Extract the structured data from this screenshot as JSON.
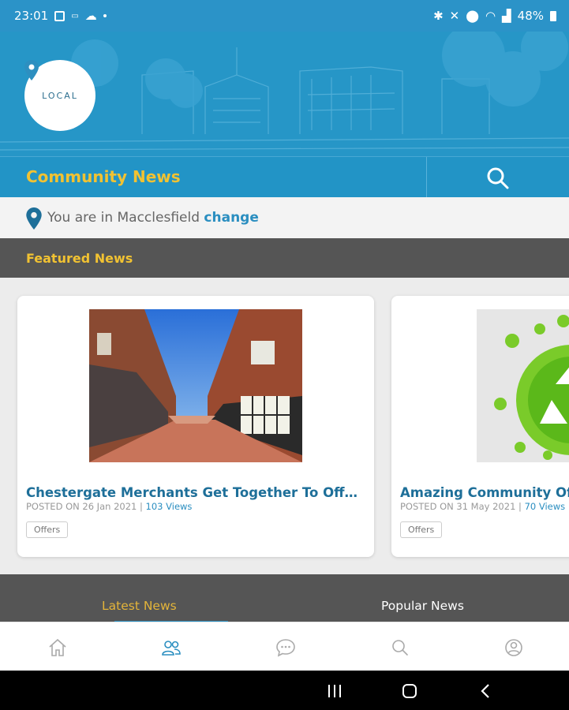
{
  "status_bar": {
    "time": "23:01",
    "battery": "48%"
  },
  "header": {
    "logo_text": "LOCAL",
    "title": "Community News"
  },
  "location": {
    "prefix": "You are in Macclesfield",
    "change_label": "change"
  },
  "featured": {
    "heading": "Featured News"
  },
  "cards": [
    {
      "title": "Chestergate Merchants Get Together To Offer ...",
      "posted": "POSTED ON 26 Jan 2021 |",
      "views": "103 Views",
      "tag": "Offers"
    },
    {
      "title": "Amazing Community Offers",
      "posted": "POSTED ON 31 May 2021 |",
      "views": "70 Views",
      "tag": "Offers"
    }
  ],
  "tabs": {
    "latest": "Latest News",
    "popular": "Popular News"
  },
  "bottom_nav": [
    "home-icon",
    "community-icon",
    "chat-icon",
    "search-icon",
    "profile-icon"
  ],
  "colors": {
    "brand_blue": "#2294c6",
    "accent_yellow": "#f1c232",
    "dark_bar": "#555555"
  }
}
